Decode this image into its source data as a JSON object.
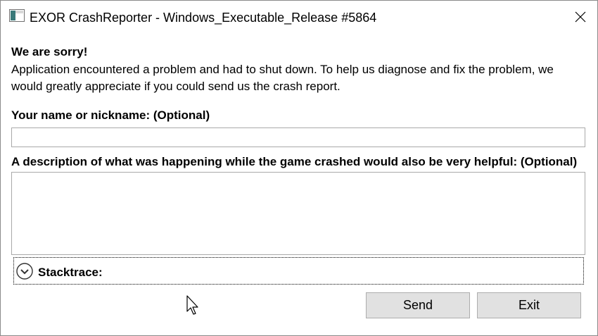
{
  "window": {
    "title": "EXOR CrashReporter - Windows_Executable_Release #5864",
    "icons": {
      "app": "app-window-icon",
      "close": "close-icon"
    }
  },
  "content": {
    "heading": "We are sorry!",
    "message": "Application encountered a problem and had to shut down. To help us diagnose and fix the problem, we would greatly appreciate if you could send us the crash report.",
    "name_label": "Your name or nickname: (Optional)",
    "name_value": "",
    "description_label": "A description of what was happening while the game crashed would also be very helpful: (Optional)",
    "description_value": "",
    "stacktrace_label": "Stacktrace:",
    "stacktrace_icon": "chevron-down-circle-icon"
  },
  "buttons": {
    "send": "Send",
    "exit": "Exit"
  },
  "colors": {
    "button_bg": "#e1e1e1",
    "button_border": "#adadad",
    "input_border": "#a9a9a9",
    "window_border": "#8a8a8a"
  }
}
